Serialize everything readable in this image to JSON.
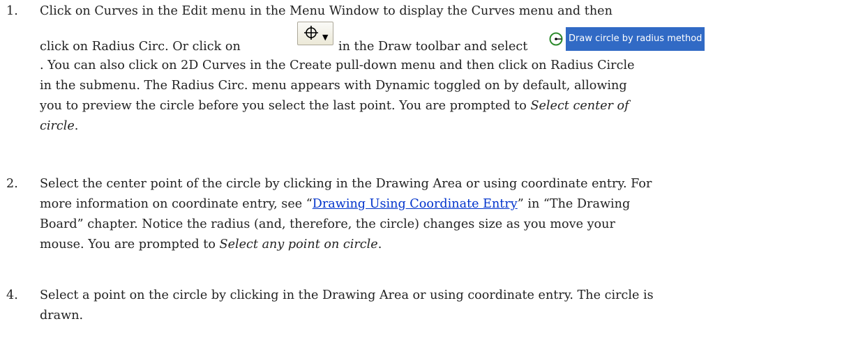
{
  "steps": [
    {
      "number": "1.",
      "lines": {
        "l1": "Click on Curves in the Edit menu in the Menu Window to display the Curves menu and then",
        "l2_a": "click on Radius Circ. Or click on",
        "l2_b": "in the Draw toolbar and select",
        "menu_item_label": "Draw circle by radius method",
        "l3": ". You can also click on 2D Curves in the Create pull-down menu and then click on Radius Circle",
        "l4": "in the submenu. The Radius Circ. menu appears with Dynamic toggled on by default, allowing",
        "l5_a": "you to preview the circle before you select the last point. You are prompted to ",
        "l5_em": "Select center of",
        "l6_em": "circle",
        "l6_b": "."
      },
      "icons": {
        "toolbar_button": "circle-crosshair-dropdown-icon",
        "menu_icon": "circle-radius-icon"
      }
    },
    {
      "number": "2.",
      "lines": {
        "l1": "Select the center point of the circle by clicking in the Drawing Area or using coordinate entry. For",
        "l2_a": "more information on coordinate entry, see “",
        "l2_link": "Drawing Using Coordinate Entry",
        "l2_b": "” in “The Drawing",
        "l3": "Board” chapter. Notice the radius (and, therefore, the circle) changes size as you move your",
        "l4_a": "mouse. You are prompted to ",
        "l4_em": "Select any point on circle",
        "l4_b": "."
      }
    },
    {
      "number": "4.",
      "lines": {
        "l1": "Select a point on the circle by clicking in the Drawing Area or using coordinate entry. The circle is",
        "l2": "drawn."
      }
    }
  ],
  "colors": {
    "link": "#0033cc",
    "menu_highlight": "#316ac5",
    "menu_icon": "#2e8b2e"
  }
}
